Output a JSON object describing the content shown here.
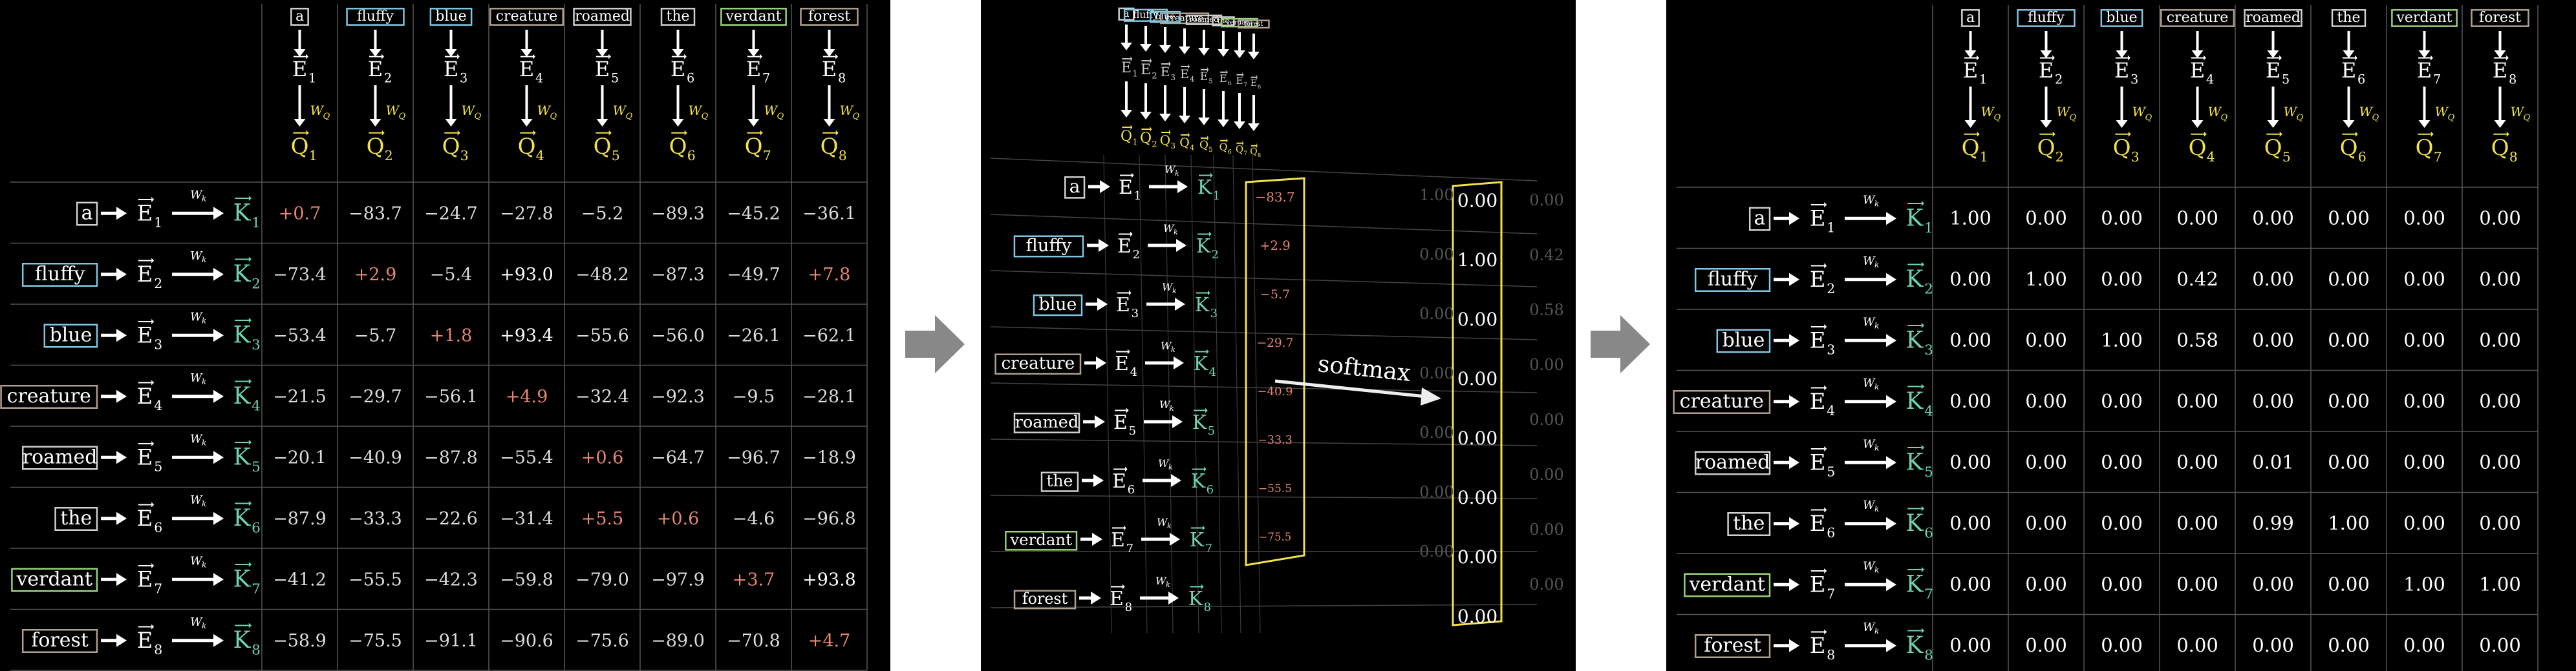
{
  "tokens": [
    "a",
    "fluffy",
    "blue",
    "creature",
    "roamed",
    "the",
    "verdant",
    "forest"
  ],
  "token_colors": [
    "#d0d0d0",
    "#7ec8e3",
    "#7ec8e3",
    "#b0a090",
    "#d0d0d0",
    "#d0d0d0",
    "#9bd27a",
    "#b0a090"
  ],
  "emb_label": "E",
  "query_label": "Q",
  "key_label": "K",
  "wq_label": "W",
  "wq_sub": "Q",
  "wk_label": "W",
  "wk_sub": "k",
  "indices": [
    "1",
    "2",
    "3",
    "4",
    "5",
    "6",
    "7",
    "8"
  ],
  "left_scores": [
    [
      "+0.7",
      "−83.7",
      "−24.7",
      "−27.8",
      "−5.2",
      "−89.3",
      "−45.2",
      "−36.1"
    ],
    [
      "−73.4",
      "+2.9",
      "−5.4",
      "+93.0",
      "−48.2",
      "−87.3",
      "−49.7",
      "+7.8"
    ],
    [
      "−53.4",
      "−5.7",
      "+1.8",
      "+93.4",
      "−55.6",
      "−56.0",
      "−26.1",
      "−62.1"
    ],
    [
      "−21.5",
      "−29.7",
      "−56.1",
      "+4.9",
      "−32.4",
      "−92.3",
      "−9.5",
      "−28.1"
    ],
    [
      "−20.1",
      "−40.9",
      "−87.8",
      "−55.4",
      "+0.6",
      "−64.7",
      "−96.7",
      "−18.9"
    ],
    [
      "−87.9",
      "−33.3",
      "−22.6",
      "−31.4",
      "+5.5",
      "+0.6",
      "−4.6",
      "−96.8"
    ],
    [
      "−41.2",
      "−55.5",
      "−42.3",
      "−59.8",
      "−79.0",
      "−97.9",
      "+3.7",
      "+93.8"
    ],
    [
      "−58.9",
      "−75.5",
      "−91.1",
      "−90.6",
      "−75.6",
      "−89.0",
      "−70.8",
      "+4.7"
    ]
  ],
  "left_highlight": [
    [
      0,
      0
    ],
    [
      1,
      1
    ],
    [
      1,
      3
    ],
    [
      2,
      2
    ],
    [
      2,
      3
    ],
    [
      3,
      3
    ],
    [
      4,
      4
    ],
    [
      5,
      4
    ],
    [
      5,
      5
    ],
    [
      6,
      6
    ],
    [
      6,
      7
    ],
    [
      7,
      7
    ]
  ],
  "mid_column_before": [
    "−83.7",
    "+2.9",
    "−5.7",
    "−29.7",
    "−40.9",
    "−33.3",
    "−55.5",
    "−75.5"
  ],
  "mid_column_after": [
    "0.00",
    "1.00",
    "0.00",
    "0.00",
    "0.00",
    "0.00",
    "0.00",
    "0.00"
  ],
  "mid_faded_right": [
    "0.00",
    "0.42",
    "0.58",
    "0.00",
    "0.00",
    "0.00",
    "0.00",
    "0.00"
  ],
  "mid_faded_left": [
    "1.00",
    "0.00",
    "0.00",
    "0.00",
    "0.00",
    "0.00",
    "0.00"
  ],
  "softmax_label": "softmax",
  "right_weights": [
    [
      "1.00",
      "0.00",
      "0.00",
      "0.00",
      "0.00",
      "0.00",
      "0.00",
      "0.00"
    ],
    [
      "0.00",
      "1.00",
      "0.00",
      "0.42",
      "0.00",
      "0.00",
      "0.00",
      "0.00"
    ],
    [
      "0.00",
      "0.00",
      "1.00",
      "0.58",
      "0.00",
      "0.00",
      "0.00",
      "0.00"
    ],
    [
      "0.00",
      "0.00",
      "0.00",
      "0.00",
      "0.00",
      "0.00",
      "0.00",
      "0.00"
    ],
    [
      "0.00",
      "0.00",
      "0.00",
      "0.00",
      "0.01",
      "0.00",
      "0.00",
      "0.00"
    ],
    [
      "0.00",
      "0.00",
      "0.00",
      "0.00",
      "0.99",
      "1.00",
      "0.00",
      "0.00"
    ],
    [
      "0.00",
      "0.00",
      "0.00",
      "0.00",
      "0.00",
      "0.00",
      "1.00",
      "1.00"
    ],
    [
      "0.00",
      "0.00",
      "0.00",
      "0.00",
      "0.00",
      "0.00",
      "0.00",
      "0.00"
    ]
  ],
  "colors": {
    "query": "#f2e24a",
    "key": "#6fd3b0",
    "positive": "#ffffff",
    "negative": "#e8866f",
    "grid": "#555555",
    "highlight_box": "#f2e24a"
  }
}
